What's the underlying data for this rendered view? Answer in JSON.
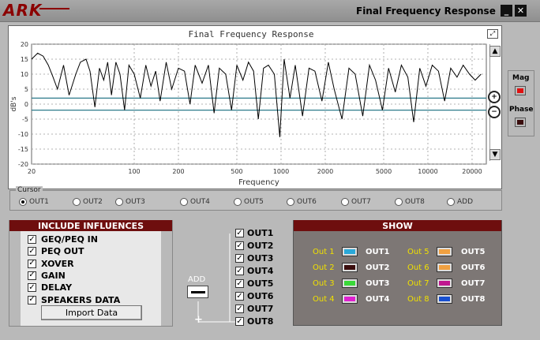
{
  "window": {
    "logo": "ARK",
    "title": "Final Frequency Response",
    "min_glyph": "_",
    "close_glyph": "✕"
  },
  "chart_data": {
    "type": "line",
    "title": "Final Frequency Response",
    "xlabel": "Frequency",
    "ylabel": "dB's",
    "xscale": "log",
    "xlim": [
      20,
      25000
    ],
    "ylim": [
      -20,
      20
    ],
    "xticks": [
      20,
      100,
      200,
      500,
      1000,
      2000,
      5000,
      10000,
      20000
    ],
    "xtick_labels": [
      "20",
      "100",
      "200",
      "500",
      "1000",
      "2000",
      "5000",
      "10000",
      "20000"
    ],
    "yticks": [
      20,
      15,
      10,
      5,
      0,
      -5,
      -10,
      -15,
      -20
    ],
    "ytick_labels": [
      "20",
      "15",
      "10",
      "5",
      "0",
      "-5",
      "-10",
      "-15",
      "-20"
    ],
    "grid": true,
    "reference_lines": [
      2,
      -2
    ],
    "series": [
      {
        "values_x": [
          20,
          22,
          24,
          26,
          28,
          30,
          33,
          36,
          40,
          43,
          47,
          50,
          54,
          58,
          62,
          66,
          70,
          75,
          80,
          86,
          92,
          100,
          110,
          120,
          130,
          140,
          150,
          165,
          180,
          200,
          220,
          240,
          260,
          290,
          320,
          350,
          380,
          420,
          460,
          500,
          550,
          600,
          650,
          700,
          760,
          820,
          900,
          980,
          1050,
          1150,
          1250,
          1400,
          1550,
          1700,
          1900,
          2100,
          2300,
          2600,
          2900,
          3200,
          3600,
          4000,
          4400,
          4900,
          5400,
          6000,
          6600,
          7300,
          8000,
          8800,
          9700,
          10700,
          11800,
          13000,
          14300,
          15800,
          17400,
          19200,
          21000,
          23000
        ],
        "values_y": [
          15,
          17,
          16,
          13,
          9,
          5,
          13,
          3,
          10,
          14,
          15,
          11,
          -1,
          12,
          8,
          14,
          3,
          14,
          10,
          -2,
          13,
          10,
          2,
          13,
          6,
          11,
          1,
          14,
          5,
          12,
          11,
          0,
          13,
          7,
          13,
          -3,
          12,
          10,
          -2,
          13,
          8,
          14,
          11,
          -5,
          12,
          13,
          10,
          -11,
          15,
          2,
          13,
          -4,
          12,
          11,
          1,
          14,
          5,
          -5,
          12,
          10,
          -4,
          13,
          8,
          -2,
          12,
          4,
          13,
          9,
          -6,
          12,
          6,
          13,
          11,
          1,
          12,
          9,
          13,
          10,
          8,
          10
        ]
      }
    ]
  },
  "cursor": {
    "legend": "Cursor",
    "options": [
      "OUT1",
      "OUT2",
      "OUT3",
      "OUT4",
      "OUT5",
      "OUT6",
      "OUT7",
      "OUT8",
      "ADD"
    ],
    "selected": "OUT1"
  },
  "side": {
    "mag_label": "Mag",
    "phase_label": "Phase",
    "mag_color": "#e01010",
    "phase_color": "#3a0d0d"
  },
  "influences": {
    "title": "INCLUDE INFLUENCES",
    "items": [
      "GEQ/PEQ IN",
      "PEQ OUT",
      "XOVER",
      "GAIN",
      "DELAY",
      "SPEAKERS DATA"
    ],
    "import_label": "Import Data",
    "check_glyph": "✓"
  },
  "add": {
    "label": "ADD",
    "plus": "+"
  },
  "outs": [
    "OUT1",
    "OUT2",
    "OUT3",
    "OUT4",
    "OUT5",
    "OUT6",
    "OUT7",
    "OUT8"
  ],
  "show": {
    "title": "SHOW",
    "left": [
      {
        "name": "Out 1",
        "out": "OUT1",
        "color": "#2aa8d8"
      },
      {
        "name": "Out 2",
        "out": "OUT2",
        "color": "#3a0d0d"
      },
      {
        "name": "Out 3",
        "out": "OUT3",
        "color": "#3ad838"
      },
      {
        "name": "Out 4",
        "out": "OUT4",
        "color": "#e020d0"
      }
    ],
    "right": [
      {
        "name": "Out 5",
        "out": "OUT5",
        "color": "#f0a040"
      },
      {
        "name": "Out 6",
        "out": "OUT6",
        "color": "#f0a040"
      },
      {
        "name": "Out 7",
        "out": "OUT7",
        "color": "#c01890"
      },
      {
        "name": "Out 8",
        "out": "OUT8",
        "color": "#1850d0"
      }
    ]
  }
}
